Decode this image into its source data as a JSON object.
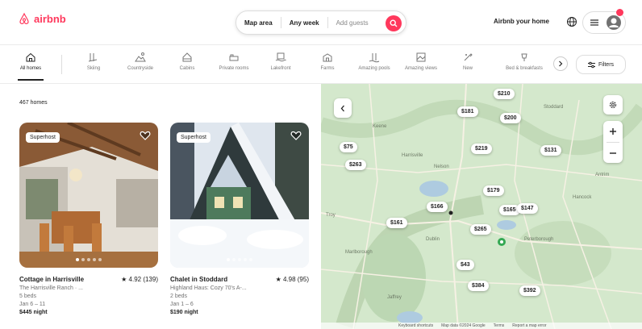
{
  "header": {
    "logo_text": "airbnb",
    "search": {
      "where": "Map area",
      "when": "Any week",
      "who": "Add guests"
    },
    "host_link": "Airbnb your home"
  },
  "categories": [
    {
      "label": "All homes",
      "icon": "home-icon",
      "active": true
    },
    {
      "label": "Skiing",
      "icon": "ski-icon"
    },
    {
      "label": "Countryside",
      "icon": "countryside-icon"
    },
    {
      "label": "Cabins",
      "icon": "cabin-icon"
    },
    {
      "label": "Private rooms",
      "icon": "private-room-icon"
    },
    {
      "label": "Lakefront",
      "icon": "lakefront-icon"
    },
    {
      "label": "Farms",
      "icon": "farm-icon"
    },
    {
      "label": "Amazing pools",
      "icon": "pool-icon"
    },
    {
      "label": "Amazing views",
      "icon": "views-icon"
    },
    {
      "label": "New",
      "icon": "new-icon"
    },
    {
      "label": "Bed & breakfasts",
      "icon": "bnb-icon"
    }
  ],
  "filters_label": "Filters",
  "results_count": "467 homes",
  "listings": [
    {
      "badge": "Superhost",
      "title": "Cottage in Harrisville",
      "rating": "★ 4.92 (139)",
      "subtitle": "The Harrisville Ranch · ...",
      "beds": "5 beds",
      "dates": "Jan 6 – 11",
      "price": "$445 night"
    },
    {
      "badge": "Superhost",
      "title": "Chalet in Stoddard",
      "rating": "★ 4.98 (95)",
      "subtitle": "Highland Haus: Cozy 70's A-...",
      "beds": "2 beds",
      "dates": "Jan 1 – 6",
      "price": "$190 night"
    }
  ],
  "map": {
    "pins": [
      "$210",
      "$181",
      "$200",
      "$75",
      "$219",
      "$131",
      "$263",
      "$179",
      "$166",
      "$165",
      "$147",
      "$161",
      "$265",
      "$43",
      "$384",
      "$392"
    ],
    "labels": [
      "Keene",
      "Harrisville",
      "Stoddard",
      "Marlborough",
      "Dublin",
      "Hancock",
      "Nelson",
      "Jaffrey",
      "Peterborough",
      "Antrim",
      "Troy"
    ],
    "attribution": [
      "Keyboard shortcuts",
      "Map data ©2024 Google",
      "Terms",
      "Report a map error"
    ]
  },
  "colors": {
    "brand": "#ff385c",
    "map_bg": "#d4e8cc"
  }
}
